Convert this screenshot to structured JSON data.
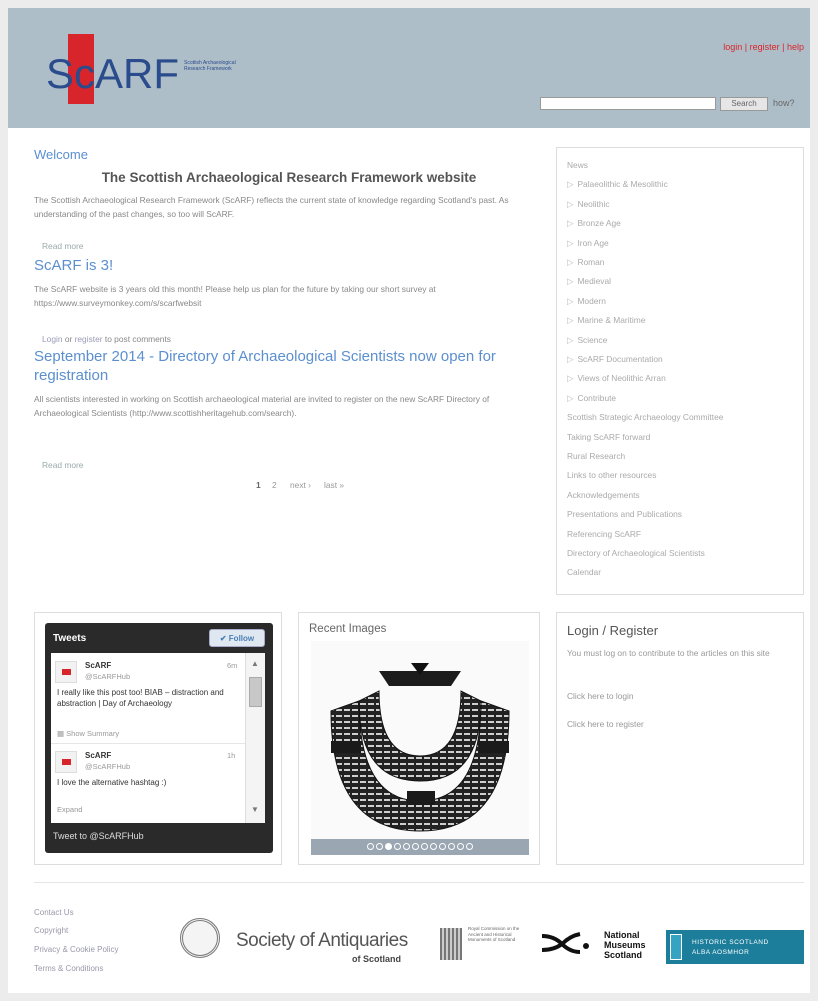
{
  "header": {
    "logo_text": "ScARF",
    "logo_subtitle": "Scottish Archaeological Research Framework",
    "login_link": "login",
    "register_link": "register",
    "help_link": "help",
    "search_value": "",
    "search_button": "Search",
    "how_link": "how?"
  },
  "main": {
    "welcome": "Welcome",
    "site_title": "The Scottish Archaeological Research Framework website",
    "intro": "The Scottish Archaeological Research Framework (ScARF) reflects the current state of knowledge regarding Scotland's past. As understanding of the past changes, so too will ScARF.",
    "read_more_1": "Read more",
    "post1_title": "ScARF is 3!",
    "post1_body": "The ScARF website is 3 years old this month! Please help us plan for the future by taking our short survey at https://www.surveymonkey.com/s/scarfwebsit",
    "post1_login": "Login",
    "post1_or": "or",
    "post1_register": "register",
    "post1_to_post": "to post comments",
    "post2_title": "September 2014 - Directory of Archaeological Scientists now open for registration",
    "post2_body": "All scientists interested in working on Scottish archaeological material are invited to register on the new ScARF Directory of Archaeological Scientists (http://www.scottishheritagehub.com/search).",
    "read_more_2": "Read more",
    "pager": {
      "page1": "1",
      "page2": "2",
      "next": "next ›",
      "last": "last »"
    }
  },
  "sidebar": {
    "items": [
      {
        "label": "News",
        "arrow": false
      },
      {
        "label": "Palaeolithic & Mesolithic",
        "arrow": true
      },
      {
        "label": "Neolithic",
        "arrow": true
      },
      {
        "label": "Bronze Age",
        "arrow": true
      },
      {
        "label": "Iron Age",
        "arrow": true
      },
      {
        "label": "Roman",
        "arrow": true
      },
      {
        "label": "Medieval",
        "arrow": true
      },
      {
        "label": "Modern",
        "arrow": true
      },
      {
        "label": "Marine & Maritime",
        "arrow": true
      },
      {
        "label": "Science",
        "arrow": true
      },
      {
        "label": "ScARF Documentation",
        "arrow": true
      },
      {
        "label": "Views of Neolithic Arran",
        "arrow": true
      },
      {
        "label": "Contribute",
        "arrow": true
      },
      {
        "label": "Scottish Strategic Archaeology Committee",
        "arrow": false
      },
      {
        "label": "Taking ScARF forward",
        "arrow": false
      },
      {
        "label": "Rural Research",
        "arrow": false
      },
      {
        "label": "Links to other resources",
        "arrow": false
      },
      {
        "label": "Acknowledgements",
        "arrow": false
      },
      {
        "label": "Presentations and Publications",
        "arrow": false
      },
      {
        "label": "Referencing ScARF",
        "arrow": false
      },
      {
        "label": "Directory of Archaeological Scientists",
        "arrow": false
      },
      {
        "label": "Calendar",
        "arrow": false
      }
    ]
  },
  "tweets": {
    "title": "Tweets",
    "follow": "Follow",
    "tweet1": {
      "name": "ScARF",
      "handle": "@ScARFHub",
      "time": "6m",
      "text": "I really like this post too! BIAB – distraction and abstraction | Day of Archaeology",
      "summary": "Show Summary"
    },
    "tweet2": {
      "name": "ScARF",
      "handle": "@ScARFHub",
      "time": "1h",
      "text": "I love the alternative hashtag :)",
      "expand": "Expand"
    },
    "tweet_to": "Tweet to @ScARFHub"
  },
  "recent_images": {
    "title": "Recent Images",
    "dot_count": 12,
    "active_dot": 2
  },
  "login_box": {
    "title": "Login / Register",
    "text": "You must log on to contribute to the articles on this site",
    "login_link": "Click here to login",
    "register_link": "Click here to register"
  },
  "footer": {
    "links": [
      "Contact Us",
      "Copyright",
      "Privacy & Cookie Policy",
      "Terms & Conditions"
    ],
    "soa_name": "Society of Antiquaries",
    "soa_sub": "of Scotland",
    "rcahms_text": "Royal Commission on the Ancient and Historical Monuments of Scotland",
    "nms_line1": "National",
    "nms_line2": "Museums",
    "nms_line3": "Scotland",
    "hs_line1": "HISTORIC SCOTLAND",
    "hs_line2": "ALBA AOSMHOR"
  }
}
